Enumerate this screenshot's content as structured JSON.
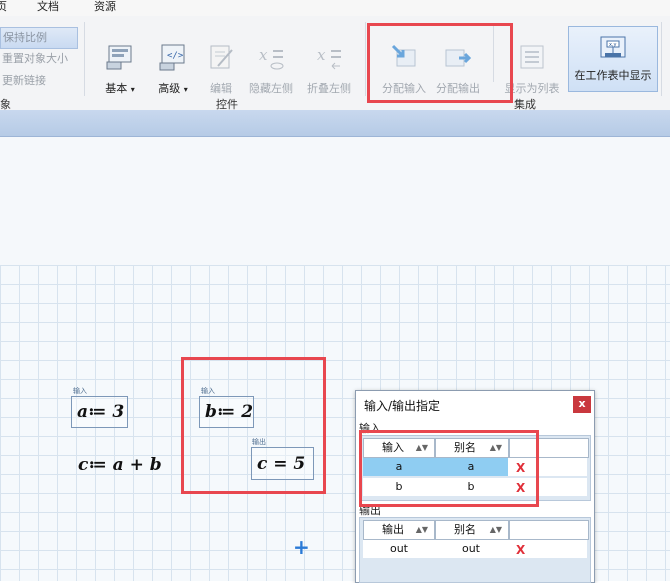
{
  "menu": {
    "items": [
      "页",
      "文档",
      "资源"
    ]
  },
  "ribbon": {
    "object_group": {
      "label": "象",
      "items": [
        "保持比例",
        "重置对象大小",
        "更新链接"
      ]
    },
    "controls_group": {
      "label": "控件",
      "buttons": [
        "基本",
        "高级",
        "编辑",
        "隐藏左侧",
        "折叠左侧"
      ]
    },
    "integration_group": {
      "label": "集成",
      "buttons": [
        "分配输入",
        "分配输出",
        "显示为列表",
        "在工作表中显示"
      ]
    }
  },
  "worksheet": {
    "tag_input": "输入",
    "tag_output": "输出",
    "expr_a": "a≔ 3",
    "expr_b": "b≔ 2",
    "expr_c_def": "c≔ a + b",
    "expr_c_out": "c = 5"
  },
  "dialog": {
    "title": "输入/输出指定",
    "close": "x",
    "input_label": "输入",
    "output_label": "输出",
    "input_headers": [
      "输入",
      "别名"
    ],
    "output_headers": [
      "输出",
      "别名"
    ],
    "input_rows": [
      {
        "name": "a",
        "alias": "a"
      },
      {
        "name": "b",
        "alias": "b"
      }
    ],
    "output_rows": [
      {
        "name": "out",
        "alias": "out"
      }
    ],
    "delete_glyph": "X"
  },
  "colors": {
    "highlight": "#e8474f",
    "selected_row": "#8fcdf2",
    "delete": "#e0303a",
    "accent": "#2a7ad6"
  }
}
